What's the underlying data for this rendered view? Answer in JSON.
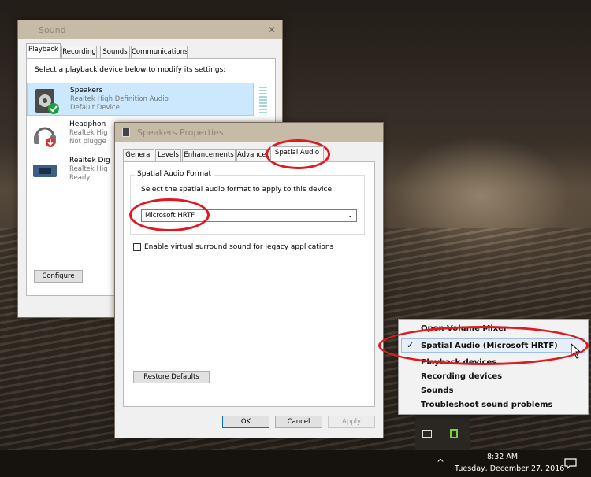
{
  "sound_window": {
    "title": "Sound",
    "close_glyph": "✕",
    "tabs": [
      "Playback",
      "Recording",
      "Sounds",
      "Communications"
    ],
    "instruction": "Select a playback device below to modify its settings:",
    "devices": [
      {
        "name": "Speakers",
        "driver": "Realtek High Definition Audio",
        "status": "Default Device",
        "icon": "speaker-icon"
      },
      {
        "name": "Headphon",
        "driver": "Realtek Hig",
        "status": "Not plugge",
        "icon": "headphones-icon"
      },
      {
        "name": "Realtek Dig",
        "driver": "Realtek Hig",
        "status": "Ready",
        "icon": "digital-output-icon"
      }
    ],
    "configure_label": "Configure"
  },
  "props_window": {
    "title": "Speakers Properties",
    "tabs": [
      "General",
      "Levels",
      "Enhancements",
      "Advanced",
      "Spatial Audio"
    ],
    "group_label": "Spatial Audio Format",
    "group_instruction": "Select the spatial audio format to apply to this device:",
    "format_value": "Microsoft HRTF",
    "checkbox_label": "Enable virtual surround sound for legacy applications",
    "restore_label": "Restore Defaults",
    "ok_label": "OK",
    "cancel_label": "Cancel",
    "apply_label": "Apply"
  },
  "context_menu": {
    "items": [
      "Open Volume Mixer",
      "Spatial Audio (Microsoft HRTF)",
      "Playback devices",
      "Recording devices",
      "Sounds",
      "Troubleshoot sound problems"
    ],
    "checked_glyph": "✓"
  },
  "taskbar": {
    "time": "8:32 AM",
    "date": "Tuesday, December 27, 2016",
    "chevron": "^"
  },
  "colors": {
    "highlight_ring": "#e0191f",
    "accent": "#0f6cbd"
  }
}
